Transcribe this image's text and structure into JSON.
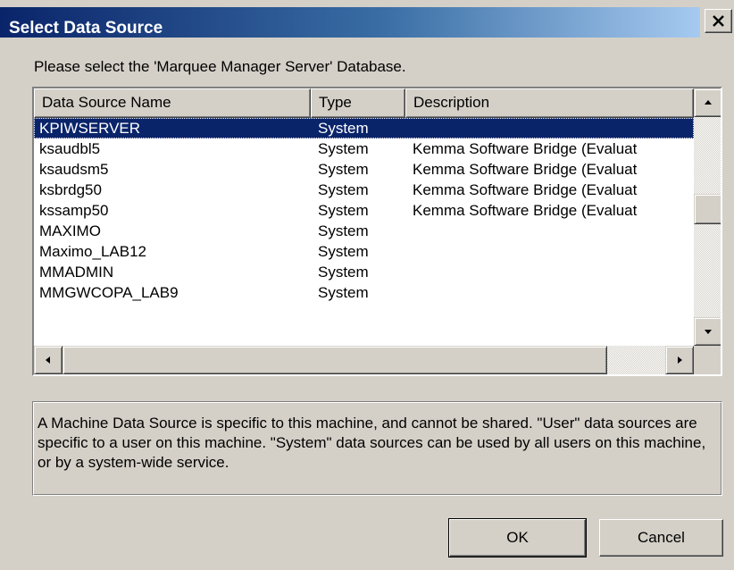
{
  "window": {
    "title": "Select Data Source",
    "close_symbol": "×"
  },
  "prompt": "Please select the 'Marquee Manager Server' Database.",
  "list": {
    "columns": [
      "Data Source Name",
      "Type",
      "Description"
    ],
    "rows": [
      {
        "name": "KPIWSERVER",
        "type": "System",
        "description": "",
        "selected": true
      },
      {
        "name": "ksaudbl5",
        "type": "System",
        "description": "Kemma Software Bridge (Evaluat"
      },
      {
        "name": "ksaudsm5",
        "type": "System",
        "description": "Kemma Software Bridge (Evaluat"
      },
      {
        "name": "ksbrdg50",
        "type": "System",
        "description": "Kemma Software Bridge (Evaluat"
      },
      {
        "name": "kssamp50",
        "type": "System",
        "description": "Kemma Software Bridge (Evaluat"
      },
      {
        "name": "MAXIMO",
        "type": "System",
        "description": ""
      },
      {
        "name": "Maximo_LAB12",
        "type": "System",
        "description": ""
      },
      {
        "name": "MMADMIN",
        "type": "System",
        "description": ""
      },
      {
        "name": "MMGWCOPA_LAB9",
        "type": "System",
        "description": ""
      }
    ],
    "vscroll_position": 0.45,
    "hscroll_position": 0.0
  },
  "info": "A Machine Data Source is specific to this machine, and cannot be shared. \"User\" data sources are specific to a user on this machine.  \"System\" data sources can be used by all users on this machine, or by a system-wide service.",
  "buttons": {
    "ok": "OK",
    "cancel": "Cancel"
  },
  "colors": {
    "title_start": "#0a246a",
    "title_end": "#a6caf0",
    "dialog_face": "#d4d0c8",
    "selection": "#0a246a"
  }
}
